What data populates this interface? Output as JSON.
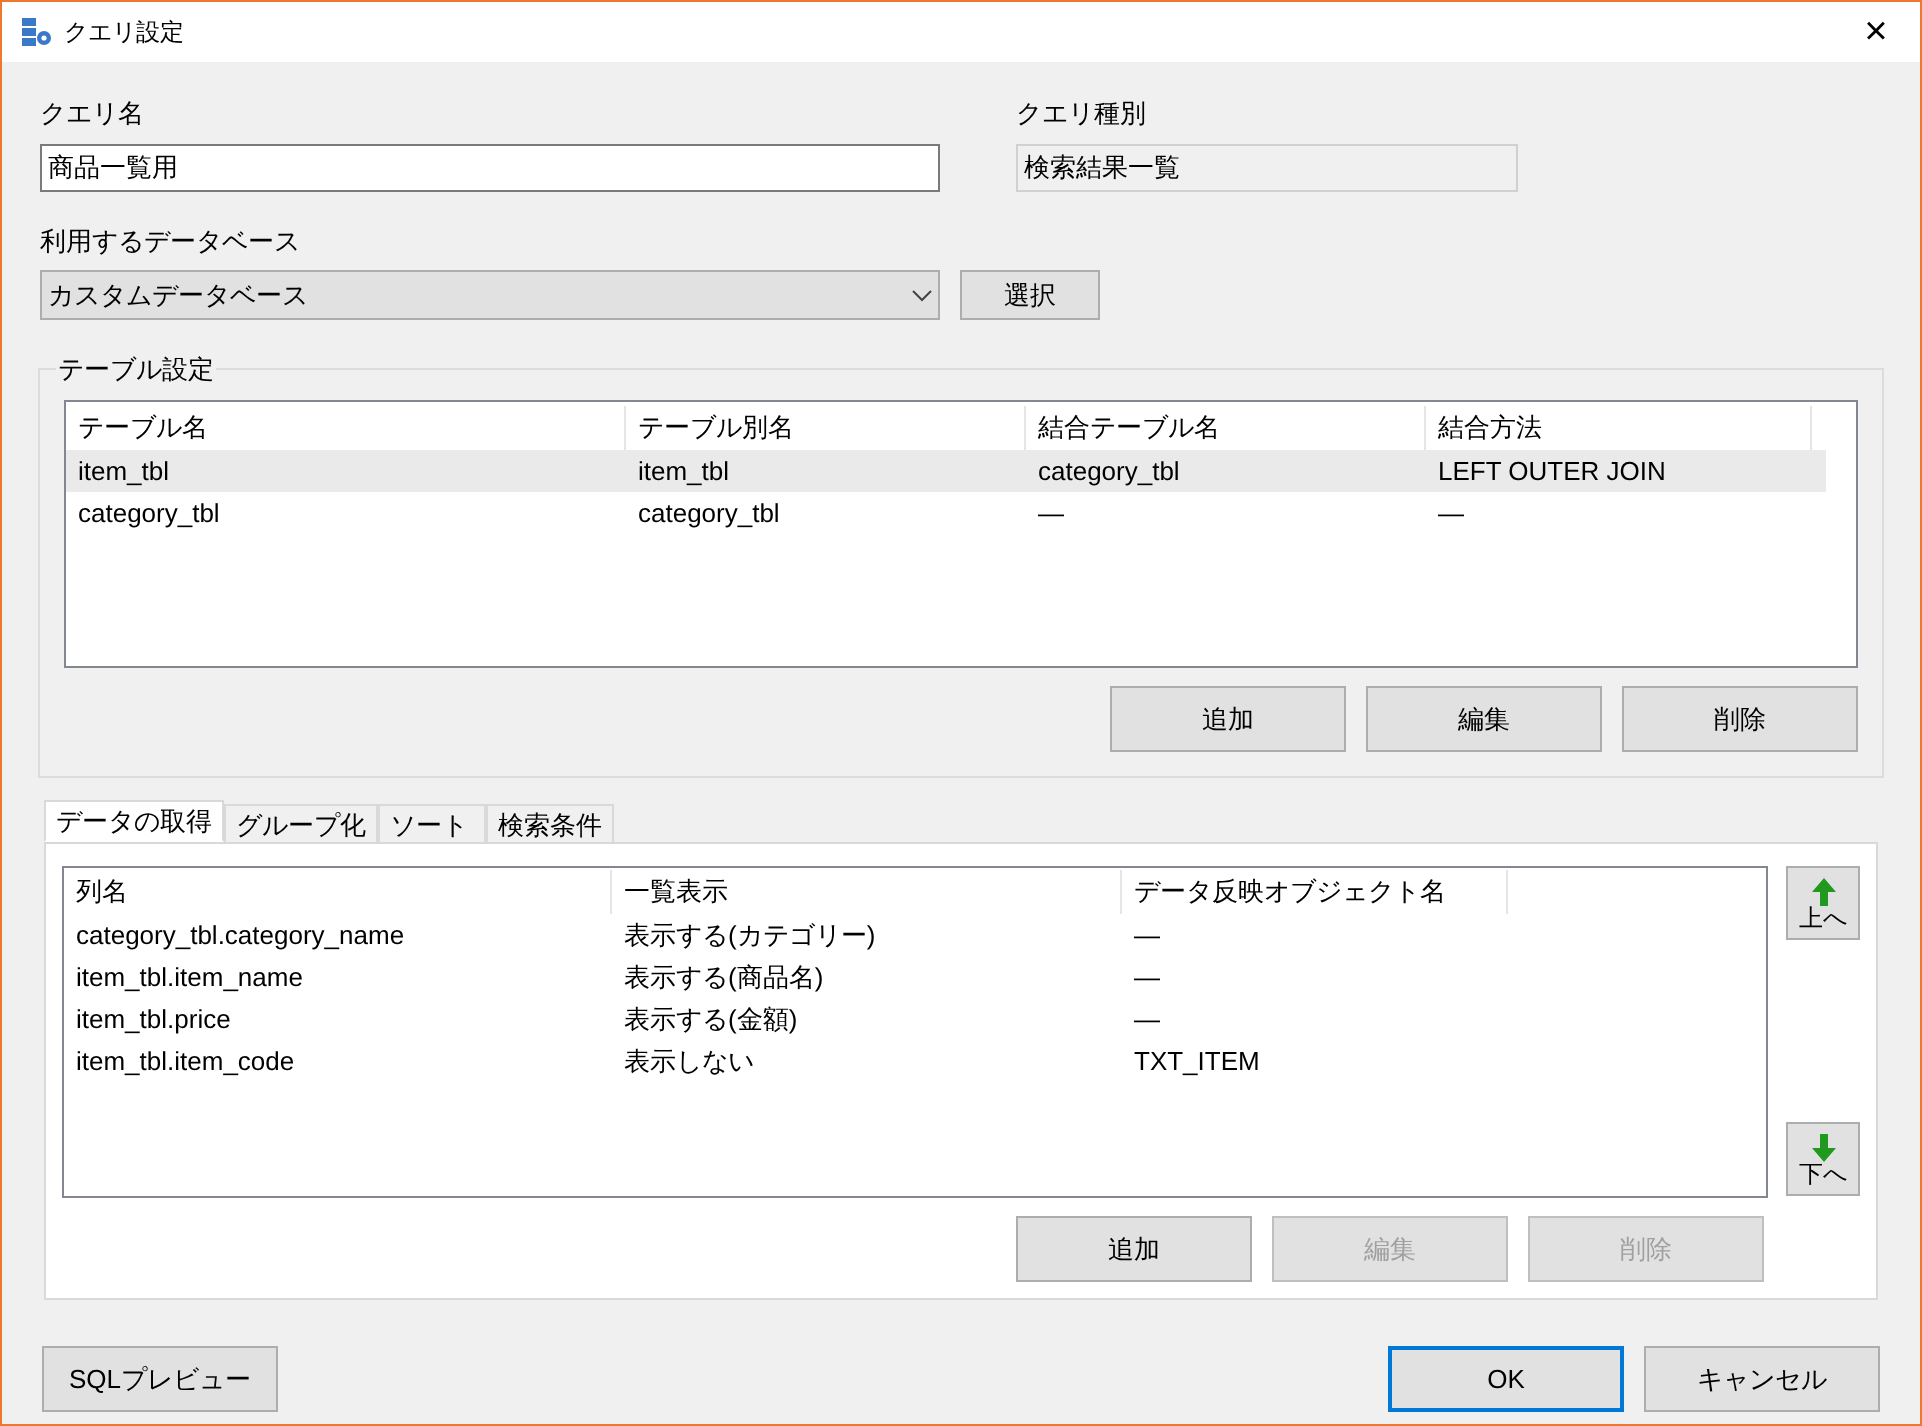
{
  "window": {
    "title": "クエリ設定",
    "close": "×"
  },
  "query_name": {
    "label": "クエリ名",
    "value": "商品一覧用"
  },
  "query_type": {
    "label": "クエリ種別",
    "value": "検索結果一覧"
  },
  "database": {
    "label": "利用するデータベース",
    "value": "カスタムデータベース",
    "button": "選択"
  },
  "table_settings": {
    "title": "テーブル設定",
    "columns": [
      "テーブル名",
      "テーブル別名",
      "結合テーブル名",
      "結合方法"
    ],
    "rows": [
      {
        "cells": [
          "item_tbl",
          "item_tbl",
          "category_tbl",
          "LEFT OUTER JOIN"
        ],
        "selected": true
      },
      {
        "cells": [
          "category_tbl",
          "category_tbl",
          "—",
          "—"
        ],
        "selected": false
      }
    ],
    "buttons": [
      {
        "label": "追加",
        "disabled": false
      },
      {
        "label": "編集",
        "disabled": false
      },
      {
        "label": "削除",
        "disabled": false
      }
    ]
  },
  "tabs": [
    {
      "label": "データの取得",
      "selected": true
    },
    {
      "label": "グループ化",
      "selected": false
    },
    {
      "label": "ソート",
      "selected": false
    },
    {
      "label": "検索条件",
      "selected": false
    }
  ],
  "fields": {
    "columns": [
      "列名",
      "一覧表示",
      "データ反映オブジェクト名"
    ],
    "rows": [
      {
        "cells": [
          "category_tbl.category_name",
          "表示する(カテゴリー)",
          "—"
        ]
      },
      {
        "cells": [
          "item_tbl.item_name",
          "表示する(商品名)",
          "—"
        ]
      },
      {
        "cells": [
          "item_tbl.price",
          "表示する(金額)",
          "—"
        ]
      },
      {
        "cells": [
          "item_tbl.item_code",
          "表示しない",
          "TXT_ITEM"
        ]
      }
    ],
    "move_up": "上へ",
    "move_down": "下へ",
    "buttons": [
      {
        "label": "追加",
        "disabled": false
      },
      {
        "label": "編集",
        "disabled": true
      },
      {
        "label": "削除",
        "disabled": true
      }
    ]
  },
  "footer": {
    "preview": {
      "label": "SQLプレビュー",
      "default": false
    },
    "ok": {
      "label": "OK",
      "default": true
    },
    "cancel": {
      "label": "キャンセル",
      "default": false
    }
  }
}
